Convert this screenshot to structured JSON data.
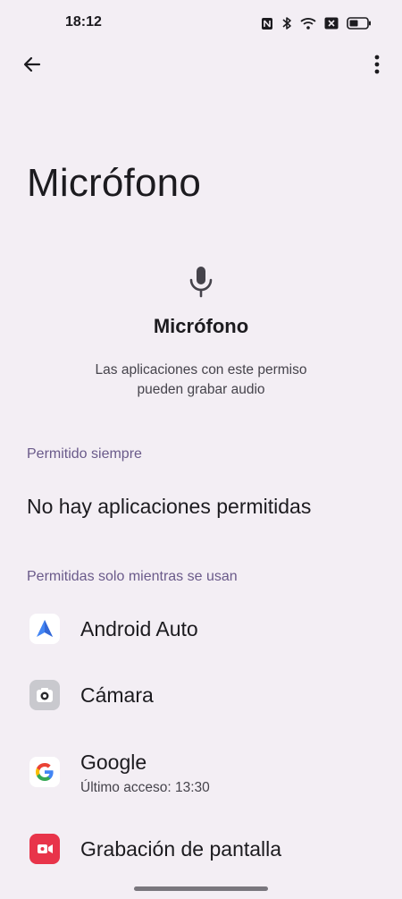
{
  "status_bar": {
    "time": "18:12",
    "icons": [
      "nfc-icon",
      "bluetooth-icon",
      "wifi-icon",
      "no-sim-icon",
      "battery-icon"
    ]
  },
  "appbar": {
    "back_icon": "arrow-back-icon",
    "more_icon": "more-vert-icon"
  },
  "page": {
    "title": "Micrófono"
  },
  "header": {
    "icon": "microphone-icon",
    "title": "Micrófono",
    "description_line1": "Las aplicaciones con este permiso",
    "description_line2": "pueden grabar audio"
  },
  "sections": {
    "always_allowed": {
      "header": "Permitido siempre",
      "empty_text": "No hay aplicaciones permitidas"
    },
    "while_in_use": {
      "header": "Permitidas solo mientras se usan",
      "apps": [
        {
          "name": "Android Auto",
          "icon": "android-auto-icon"
        },
        {
          "name": "Cámara",
          "icon": "camera-icon"
        },
        {
          "name": "Google",
          "subtitle": "Último acceso: 13:30",
          "icon": "google-icon"
        },
        {
          "name": "Grabación de pantalla",
          "icon": "screen-recorder-icon"
        }
      ]
    }
  },
  "colors": {
    "background": "#f3eef4",
    "section_header": "#6a5a8a",
    "primary_text": "#1c1b1f",
    "secondary_text": "#45434b",
    "recorder_red": "#e8344a"
  }
}
